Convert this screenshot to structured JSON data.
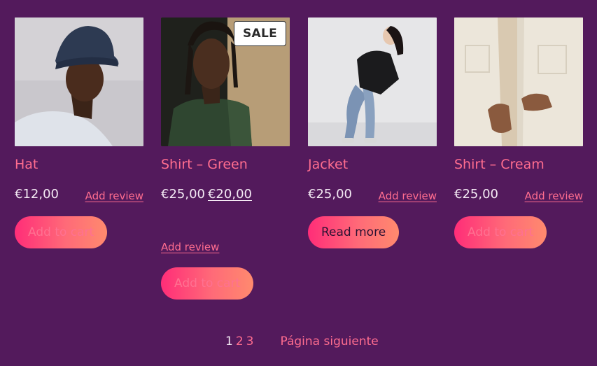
{
  "products": [
    {
      "title": "Hat",
      "price": "€12,00",
      "review_label": "Add review",
      "button_label": "Add to cart",
      "image_desc": "man-in-bucket-hat"
    },
    {
      "title": "Shirt – Green",
      "sale_badge": "SALE",
      "price_old": "€25,00",
      "price_new": "€20,00",
      "review_label": "Add review",
      "button_label": "Add to cart",
      "image_desc": "man-in-green-shirt"
    },
    {
      "title": "Jacket",
      "price": "€25,00",
      "review_label": "Add review",
      "button_label": "Read more",
      "image_desc": "woman-in-black-jacket"
    },
    {
      "title": "Shirt – Cream",
      "price": "€25,00",
      "review_label": "Add review",
      "button_label": "Add to cart",
      "image_desc": "cream-shirt-closeup"
    }
  ],
  "pagination": {
    "current": "1",
    "pages": [
      "2",
      "3"
    ],
    "next_label": "Página siguiente"
  },
  "colors": {
    "background": "#531a5c",
    "accent": "#ff6d8f",
    "button_gradient_start": "#ff2d78",
    "button_gradient_end": "#ff8a6e"
  }
}
